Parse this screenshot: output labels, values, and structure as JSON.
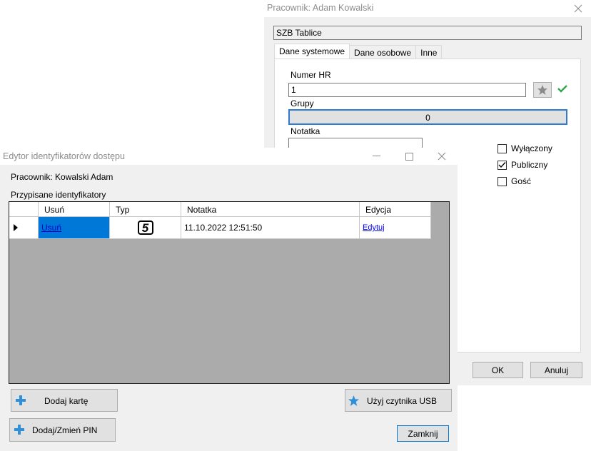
{
  "employee_window": {
    "title": "Pracownik:  Adam Kowalski",
    "company_field": "SZB Tablice",
    "tabs": [
      "Dane systemowe",
      "Dane osobowe",
      "Inne"
    ],
    "hr_number_label": "Numer HR",
    "hr_number_value": "1",
    "groups_label": "Grupy",
    "groups_value": "0",
    "note_label": "Notatka",
    "checkboxes": [
      {
        "label": "Wyłączony",
        "checked": false
      },
      {
        "label": "Publiczny",
        "checked": true
      },
      {
        "label": "Gość",
        "checked": false
      }
    ],
    "ok_label": "OK",
    "cancel_label": "Anuluj"
  },
  "editor_window": {
    "title": "Edytor identyfikatorów dostępu",
    "employee_label": "Pracownik: Kowalski Adam",
    "assigned_label": "Przypisane identyfikatory",
    "columns": [
      "Usuń",
      "Typ",
      "Notatka",
      "Edycja"
    ],
    "rows": [
      {
        "remove": "Usuń",
        "type_glyph": "5",
        "note": "11.10.2022 12:51:50",
        "edit": "Edytuj"
      }
    ],
    "add_card_label": "Dodaj kartę",
    "add_pin_label": "Dodaj/Zmień PIN",
    "usb_label": "Użyj czytnika USB",
    "close_label": "Zamknij"
  },
  "colors": {
    "selection": "#0078d7",
    "link": "#0000ff",
    "grid_bg": "#ababab",
    "plus_icon": "#2f8fd8",
    "check_green": "#2fa84f",
    "groups_border": "#2f7bd1"
  }
}
